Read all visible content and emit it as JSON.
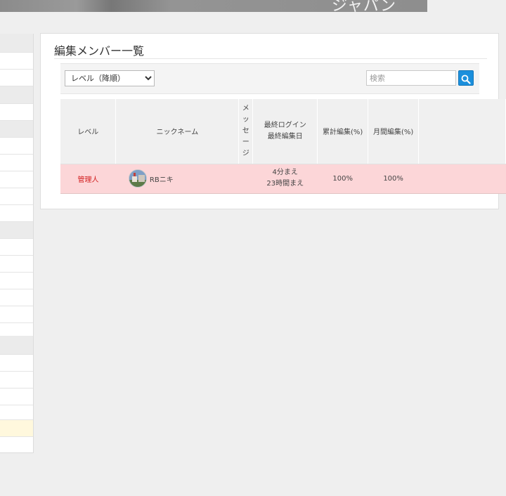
{
  "banner": {
    "text": "ジャパン"
  },
  "panel": {
    "title": "編集メンバー一覧"
  },
  "toolbar": {
    "sort_select": {
      "selected": "レベル（降順）",
      "options": [
        "レベル（降順）"
      ]
    },
    "search": {
      "placeholder": "検索",
      "value": ""
    },
    "search_icon": "magnifier-icon"
  },
  "table": {
    "headers": {
      "level": "レベル",
      "nickname": "ニックネーム",
      "message": "メッセージ",
      "last_login": "最終ログイン",
      "last_edit": "最終編集日",
      "total_edits": "累計編集(%)",
      "monthly_edits": "月間編集(%)"
    },
    "rows": [
      {
        "level": "管理人",
        "nickname": "RBニキ",
        "last_login": "4分まえ",
        "last_edit": "23時間まえ",
        "total_edits": "100%",
        "monthly_edits": "100%"
      }
    ]
  },
  "colors": {
    "admin_row_bg": "#fcd6d8",
    "admin_level_text": "#d21e1e",
    "search_button": "#1b8fdc",
    "sidebar_highlight": "#fff8dd"
  }
}
